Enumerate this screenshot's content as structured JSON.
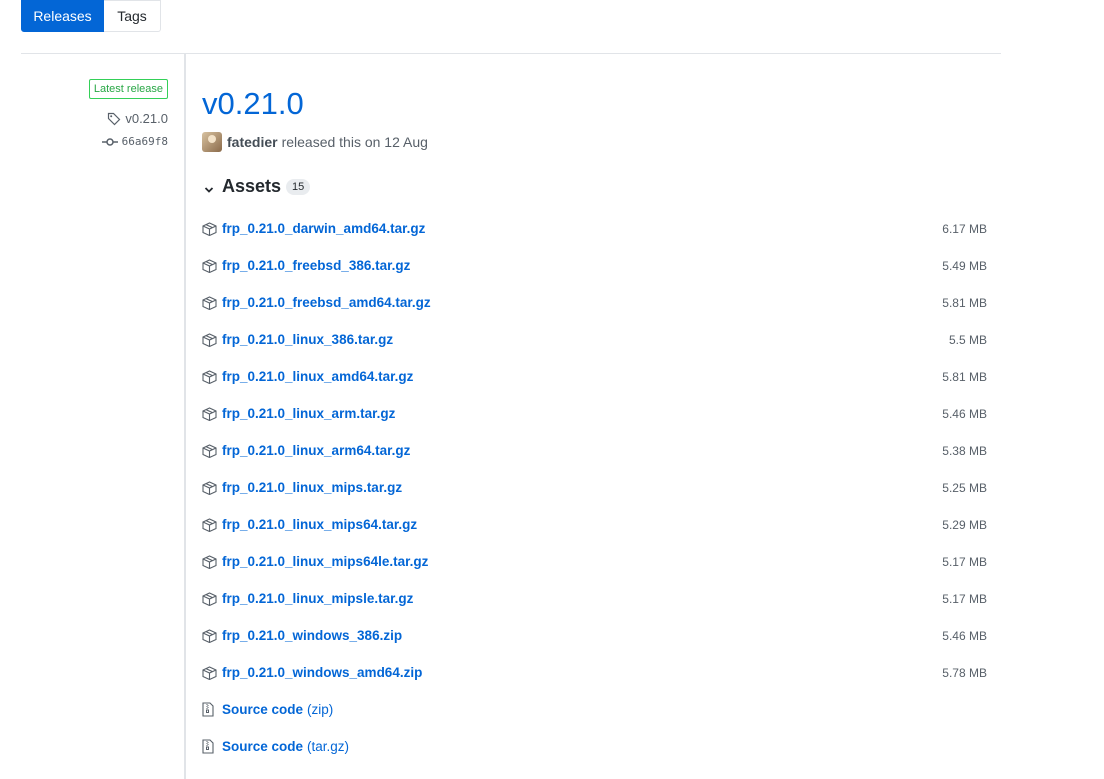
{
  "tabs": [
    {
      "label": "Releases",
      "selected": true
    },
    {
      "label": "Tags",
      "selected": false
    }
  ],
  "sidebar": {
    "badge": "Latest release",
    "tag": "v0.21.0",
    "commit": "66a69f8"
  },
  "release": {
    "title": "v0.21.0",
    "author": "fatedier",
    "released_text": "released this on 12 Aug"
  },
  "assets": {
    "title": "Assets",
    "count": "15",
    "files": [
      {
        "name": "frp_0.21.0_darwin_amd64.tar.gz",
        "size": "6.17 MB"
      },
      {
        "name": "frp_0.21.0_freebsd_386.tar.gz",
        "size": "5.49 MB"
      },
      {
        "name": "frp_0.21.0_freebsd_amd64.tar.gz",
        "size": "5.81 MB"
      },
      {
        "name": "frp_0.21.0_linux_386.tar.gz",
        "size": "5.5 MB"
      },
      {
        "name": "frp_0.21.0_linux_amd64.tar.gz",
        "size": "5.81 MB"
      },
      {
        "name": "frp_0.21.0_linux_arm.tar.gz",
        "size": "5.46 MB"
      },
      {
        "name": "frp_0.21.0_linux_arm64.tar.gz",
        "size": "5.38 MB"
      },
      {
        "name": "frp_0.21.0_linux_mips.tar.gz",
        "size": "5.25 MB"
      },
      {
        "name": "frp_0.21.0_linux_mips64.tar.gz",
        "size": "5.29 MB"
      },
      {
        "name": "frp_0.21.0_linux_mips64le.tar.gz",
        "size": "5.17 MB"
      },
      {
        "name": "frp_0.21.0_linux_mipsle.tar.gz",
        "size": "5.17 MB"
      },
      {
        "name": "frp_0.21.0_windows_386.zip",
        "size": "5.46 MB"
      },
      {
        "name": "frp_0.21.0_windows_amd64.zip",
        "size": "5.78 MB"
      }
    ],
    "sources": [
      {
        "name": "Source code",
        "format": "(zip)"
      },
      {
        "name": "Source code",
        "format": "(tar.gz)"
      }
    ]
  },
  "colors": {
    "link": "#0366d6",
    "badge_green": "#28a745",
    "selected_tab": "#0366d6"
  },
  "icons": {
    "tag": "tag-icon",
    "commit": "git-commit-icon",
    "chevron": "chevron-down-icon",
    "package": "package-icon",
    "zip": "file-zip-icon"
  }
}
